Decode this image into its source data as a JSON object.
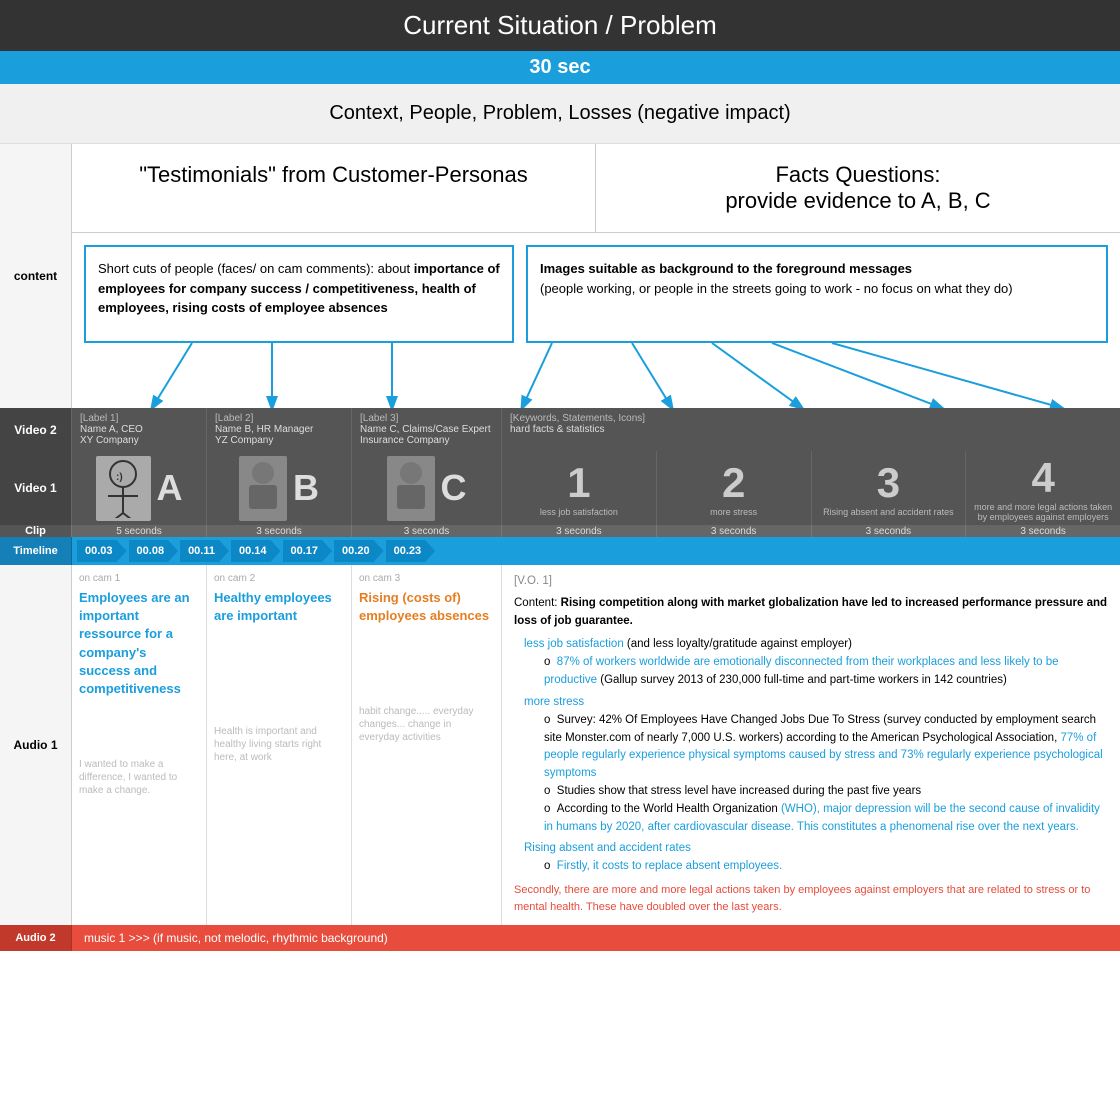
{
  "title": "Current Situation / Problem",
  "duration": "30 sec",
  "subtitle": "Context, People, Problem, Losses (negative impact)",
  "sidebar_labels": {
    "content": "content",
    "video2": "Video 2",
    "video1": "Video 1",
    "clip": "Clip",
    "timeline": "Timeline",
    "audio1": "Audio 1",
    "audio2": "Audio 2"
  },
  "columns": {
    "left_title": "\"Testimonials\" from Customer-Personas",
    "right_title": "Facts Questions:\nprovide evidence to A, B, C"
  },
  "box_testimonial": {
    "text": "Short cuts of people (faces/ on cam comments): about importance of employees for company success / competitiveness, health of employees, rising costs of employee absences"
  },
  "box_facts": {
    "text_bold": "Images suitable as background to the foreground messages",
    "text_normal": "(people working, or people in the streets going to work - no focus on what they do)"
  },
  "video2_segments": [
    {
      "label": "[Label 1]",
      "name": "Name A, CEO",
      "company": "XY Company"
    },
    {
      "label": "[Label 2]",
      "name": "Name B, HR Manager",
      "company": "YZ Company"
    },
    {
      "label": "[Label 3]",
      "name": "Name C, Claims/Case Expert",
      "company": "Insurance Company"
    },
    {
      "label": "[Keywords, Statements, Icons]",
      "name": "hard facts & statistics",
      "company": ""
    }
  ],
  "video1_segments": [
    {
      "type": "person",
      "letter": "A"
    },
    {
      "type": "person",
      "letter": "B"
    },
    {
      "type": "person",
      "letter": "C"
    },
    {
      "type": "number",
      "number": "1",
      "text": "less job satisfaction"
    },
    {
      "type": "number",
      "number": "2",
      "text": "more stress"
    },
    {
      "type": "number",
      "number": "3",
      "text": "Rising absent and accident rates"
    },
    {
      "type": "number",
      "number": "4",
      "text": "more and more legal actions taken by employees against employers"
    }
  ],
  "clip_segments": [
    "5 seconds",
    "3 seconds",
    "3 seconds",
    "3 seconds",
    "3 seconds",
    "3 seconds",
    "3 seconds"
  ],
  "timeline_times": [
    "00.03",
    "00.08",
    "00.11",
    "00.14",
    "00.17",
    "00.20",
    "00.23"
  ],
  "oncam": [
    {
      "title": "on cam 1",
      "text": "Employees are an important ressource for a company's success and competitiveness",
      "subtext": "I wanted to make a difference, I wanted to make a change."
    },
    {
      "title": "on cam 2",
      "text": "Healthy employees are important",
      "subtext": "Health is important and healthy living starts right here, at work"
    },
    {
      "title": "on cam 3",
      "text": "Rising (costs of) employees absences",
      "subtext": "habit change..... everyday changes... change in everyday activities"
    }
  ],
  "vo": {
    "label": "[V.O. 1]",
    "content_prefix": "Content: ",
    "content_bold": "Rising competition along with market globalization have led to increased performance pressure and loss of job guarantee.",
    "points": [
      {
        "text_blue": "less job satisfaction",
        "text": " (and less loyalty/gratitude against employer)",
        "subpoints": [
          {
            "text_blue": "87% of workers worldwide are emotionally disconnected from their workplaces and less likely to be productive",
            "text": " (Gallup survey 2013 of 230,000 full-time and part-time workers in 142 countries)"
          }
        ]
      },
      {
        "text_blue": "more stress",
        "text": "",
        "subpoints": [
          {
            "text": "Survey: 42% Of Employees Have Changed Jobs Due To Stress (survey conducted by employment search site Monster.com of nearly 7,000 U.S. workers) according to the American Psychological Association, ",
            "text_blue": "77% of people regularly experience physical symptoms caused by stress and 73% regularly experience psychological symptoms",
            "text2": ""
          },
          {
            "text": "Studies show that stress level have increased during the past five years"
          },
          {
            "text": "According to the World Health Organization ",
            "text_blue": "(WHO), major depression will be the second cause of invalidity in humans by 2020, after cardiovascular disease. This constitutes a phenomenal rise over the next years.",
            "text2": ""
          }
        ]
      },
      {
        "text_blue": "Rising absent and accident rates",
        "text": "",
        "subpoints": [
          {
            "text_blue": "Firstly, it costs to replace absent employees.",
            "text": ""
          }
        ]
      }
    ],
    "footer": "Secondly, there are more and more legal actions taken by employees against employers that are related to stress or to mental health. These have doubled over the last years."
  },
  "audio2_text": "music 1 >>>  (if music, not melodic, rhythmic background)"
}
